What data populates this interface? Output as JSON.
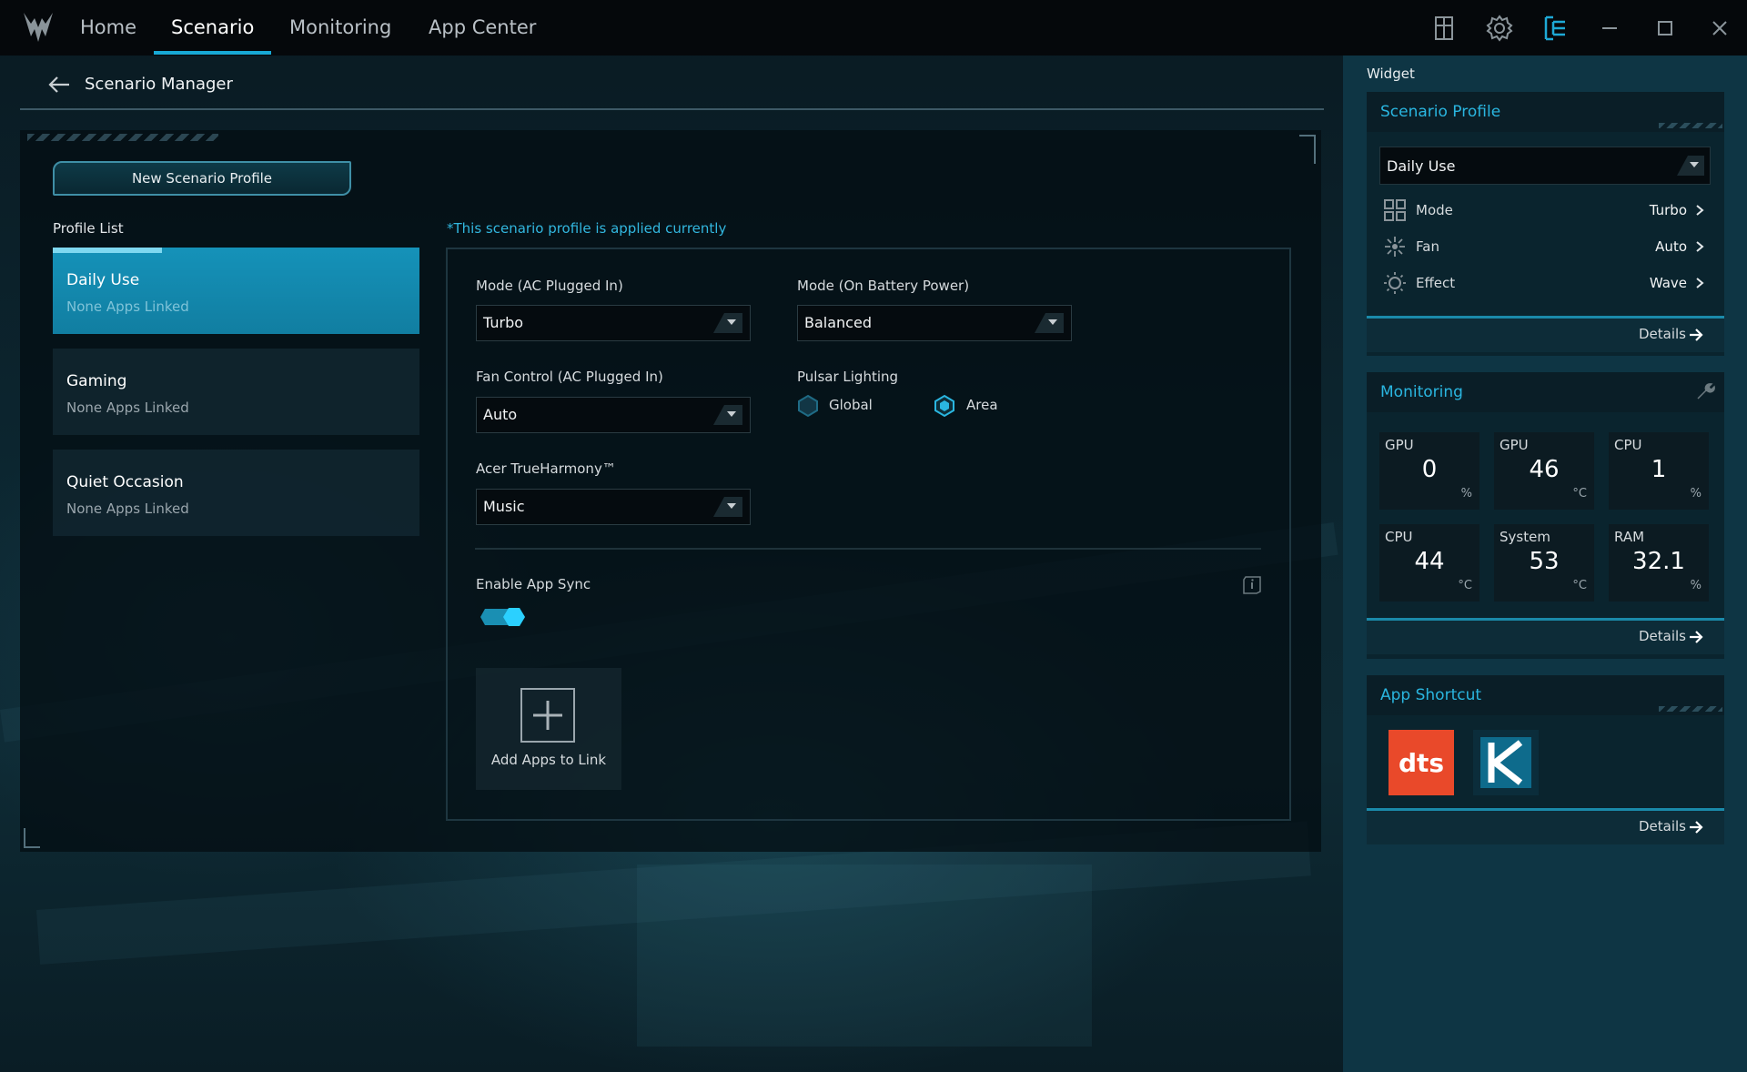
{
  "nav": {
    "tabs": [
      {
        "label": "Home"
      },
      {
        "label": "Scenario"
      },
      {
        "label": "Monitoring"
      },
      {
        "label": "App Center"
      }
    ],
    "active_index": 1
  },
  "page": {
    "title": "Scenario Manager",
    "new_profile_button": "New Scenario Profile",
    "profile_list_label": "Profile List",
    "profiles": [
      {
        "name": "Daily Use",
        "sub": "None Apps Linked"
      },
      {
        "name": "Gaming",
        "sub": "None Apps Linked"
      },
      {
        "name": "Quiet Occasion",
        "sub": "None Apps Linked"
      }
    ],
    "applied_note": "*This scenario profile is applied currently"
  },
  "settings": {
    "mode_ac": {
      "label": "Mode (AC Plugged In)",
      "value": "Turbo"
    },
    "mode_battery": {
      "label": "Mode (On Battery Power)",
      "value": "Balanced"
    },
    "fan_control": {
      "label": "Fan Control (AC Plugged In)",
      "value": "Auto"
    },
    "pulsar": {
      "label": "Pulsar Lighting",
      "options": [
        "Global",
        "Area"
      ],
      "selected": "Area"
    },
    "trueharmony": {
      "label": "Acer TrueHarmony™",
      "value": "Music"
    },
    "app_sync": {
      "label": "Enable App Sync",
      "enabled": true
    },
    "add_apps_label": "Add Apps to Link"
  },
  "sidebar": {
    "title": "Widget",
    "scenario_profile": {
      "title": "Scenario Profile",
      "selected": "Daily Use",
      "rows": [
        {
          "label": "Mode",
          "value": "Turbo",
          "icon": "grid-icon"
        },
        {
          "label": "Fan",
          "value": "Auto",
          "icon": "fan-icon"
        },
        {
          "label": "Effect",
          "value": "Wave",
          "icon": "sun-icon"
        }
      ],
      "details": "Details"
    },
    "monitoring": {
      "title": "Monitoring",
      "tiles": [
        {
          "label": "GPU",
          "value": "0",
          "unit": "%"
        },
        {
          "label": "GPU",
          "value": "46",
          "unit": "°C"
        },
        {
          "label": "CPU",
          "value": "1",
          "unit": "%"
        },
        {
          "label": "CPU",
          "value": "44",
          "unit": "°C"
        },
        {
          "label": "System",
          "value": "53",
          "unit": "°C"
        },
        {
          "label": "RAM",
          "value": "32.1",
          "unit": "%"
        }
      ],
      "details": "Details"
    },
    "app_shortcut": {
      "title": "App Shortcut",
      "apps": [
        {
          "name": "dts",
          "icon": "dts-icon",
          "color": "#e9492a"
        },
        {
          "name": "K",
          "icon": "killer-icon",
          "color": "#0e6b8c"
        }
      ],
      "details": "Details"
    }
  },
  "colors": {
    "accent": "#17a9d6",
    "active_card": "#1592b9",
    "sidebar_bg": "#0e3544"
  }
}
